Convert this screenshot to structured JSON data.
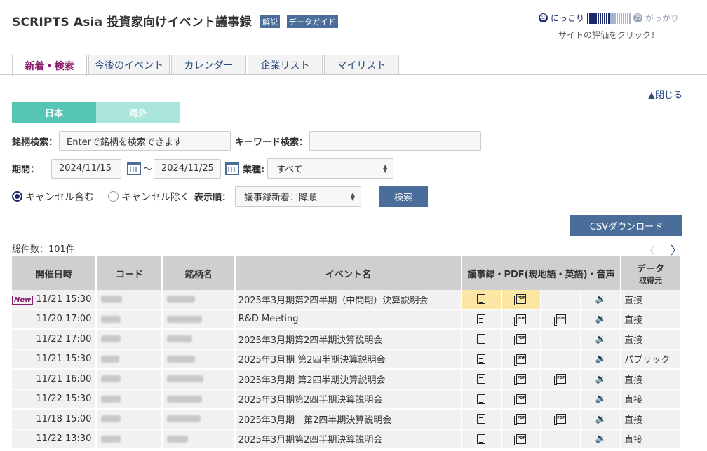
{
  "header": {
    "title": "SCRIPTS Asia 投資家向けイベント議事録",
    "badge_explain": "解説",
    "badge_guide": "データガイド"
  },
  "rating": {
    "good_label": "にっこり",
    "bad_label": "がっかり",
    "hint": "サイトの評価をクリック！"
  },
  "tabs": [
    {
      "label": "新着・検索"
    },
    {
      "label": "今後のイベント"
    },
    {
      "label": "カレンダー"
    },
    {
      "label": "企業リスト"
    },
    {
      "label": "マイリスト"
    }
  ],
  "close_link": "▲閉じる",
  "region": {
    "japan": "日本",
    "overseas": "海外"
  },
  "search": {
    "stock_label": "銘柄検索：",
    "stock_placeholder": "Enterで銘柄を検索できます",
    "keyword_label": "キーワード検索：",
    "keyword_value": "",
    "period_label": "期間：",
    "date_from": "2024/11/15",
    "tilde": "～",
    "date_to": "2024/11/25",
    "industry_label": "業種:",
    "industry_value": "すべて",
    "radio_include": "キャンセル含む",
    "radio_exclude": "キャンセル除く",
    "order_label": "表示順：",
    "order_value": "議事録新着：降順",
    "search_button": "検索"
  },
  "csv_button": "CSVダウンロード",
  "total_count": "総件数：101件",
  "pager": {
    "prev": "〈",
    "next": "〉"
  },
  "table": {
    "headers": {
      "datetime": "開催日時",
      "code": "コード",
      "name": "銘柄名",
      "event": "イベント名",
      "docs": "議事録・PDF(現地語・英語)・音声",
      "source_line1": "データ",
      "source_line2": "取得元"
    },
    "new_label": "New",
    "rows": [
      {
        "datetime": "11/21 15:30",
        "event": "2025年3月期第2四半期（中間期）決算説明会",
        "source": "直接"
      },
      {
        "datetime": "11/20 17:00",
        "event": "R&D Meeting",
        "source": "直接"
      },
      {
        "datetime": "11/22 17:00",
        "event": "2025年3月期第2四半期決算説明会",
        "source": "直接"
      },
      {
        "datetime": "11/21 15:30",
        "event": "2025年3月期 第2四半期決算説明会",
        "source": "パブリック"
      },
      {
        "datetime": "11/21 16:00",
        "event": "2025年3月期 第2四半期決算説明会",
        "source": "直接"
      },
      {
        "datetime": "11/22 15:30",
        "event": "2025年3月期第2四半期決算説明会",
        "source": "直接"
      },
      {
        "datetime": "11/18 15:00",
        "event": "2025年3月期　第2四半期決算説明会",
        "source": "直接"
      },
      {
        "datetime": "11/22 13:30",
        "event": "2025年3月期第2四半期決算説明会",
        "source": "直接"
      }
    ]
  }
}
